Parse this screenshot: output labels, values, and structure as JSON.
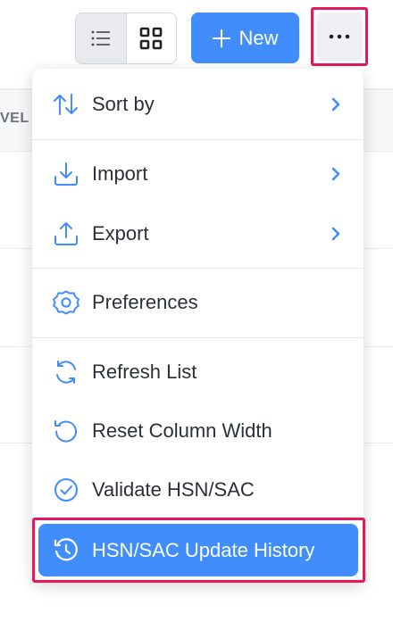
{
  "toolbar": {
    "new_label": "New",
    "list_view_icon": "list-icon",
    "grid_view_icon": "grid-icon",
    "more_icon": "ellipsis-icon"
  },
  "background": {
    "column_header_fragment": "VEL"
  },
  "menu": {
    "items": [
      {
        "label": "Sort by",
        "icon": "sort-arrows-icon",
        "has_submenu": true
      },
      {
        "label": "Import",
        "icon": "import-icon",
        "has_submenu": true
      },
      {
        "label": "Export",
        "icon": "export-icon",
        "has_submenu": true
      },
      {
        "label": "Preferences",
        "icon": "gear-icon",
        "has_submenu": false
      },
      {
        "label": "Refresh List",
        "icon": "refresh-icon",
        "has_submenu": false
      },
      {
        "label": "Reset Column Width",
        "icon": "reset-icon",
        "has_submenu": false
      },
      {
        "label": "Validate HSN/SAC",
        "icon": "check-circle-icon",
        "has_submenu": false
      },
      {
        "label": "HSN/SAC Update History",
        "icon": "history-icon",
        "has_submenu": false,
        "active": true
      }
    ]
  },
  "colors": {
    "accent": "#408dfb",
    "highlight_border": "#e5185a",
    "text": "#2b2f3a"
  }
}
